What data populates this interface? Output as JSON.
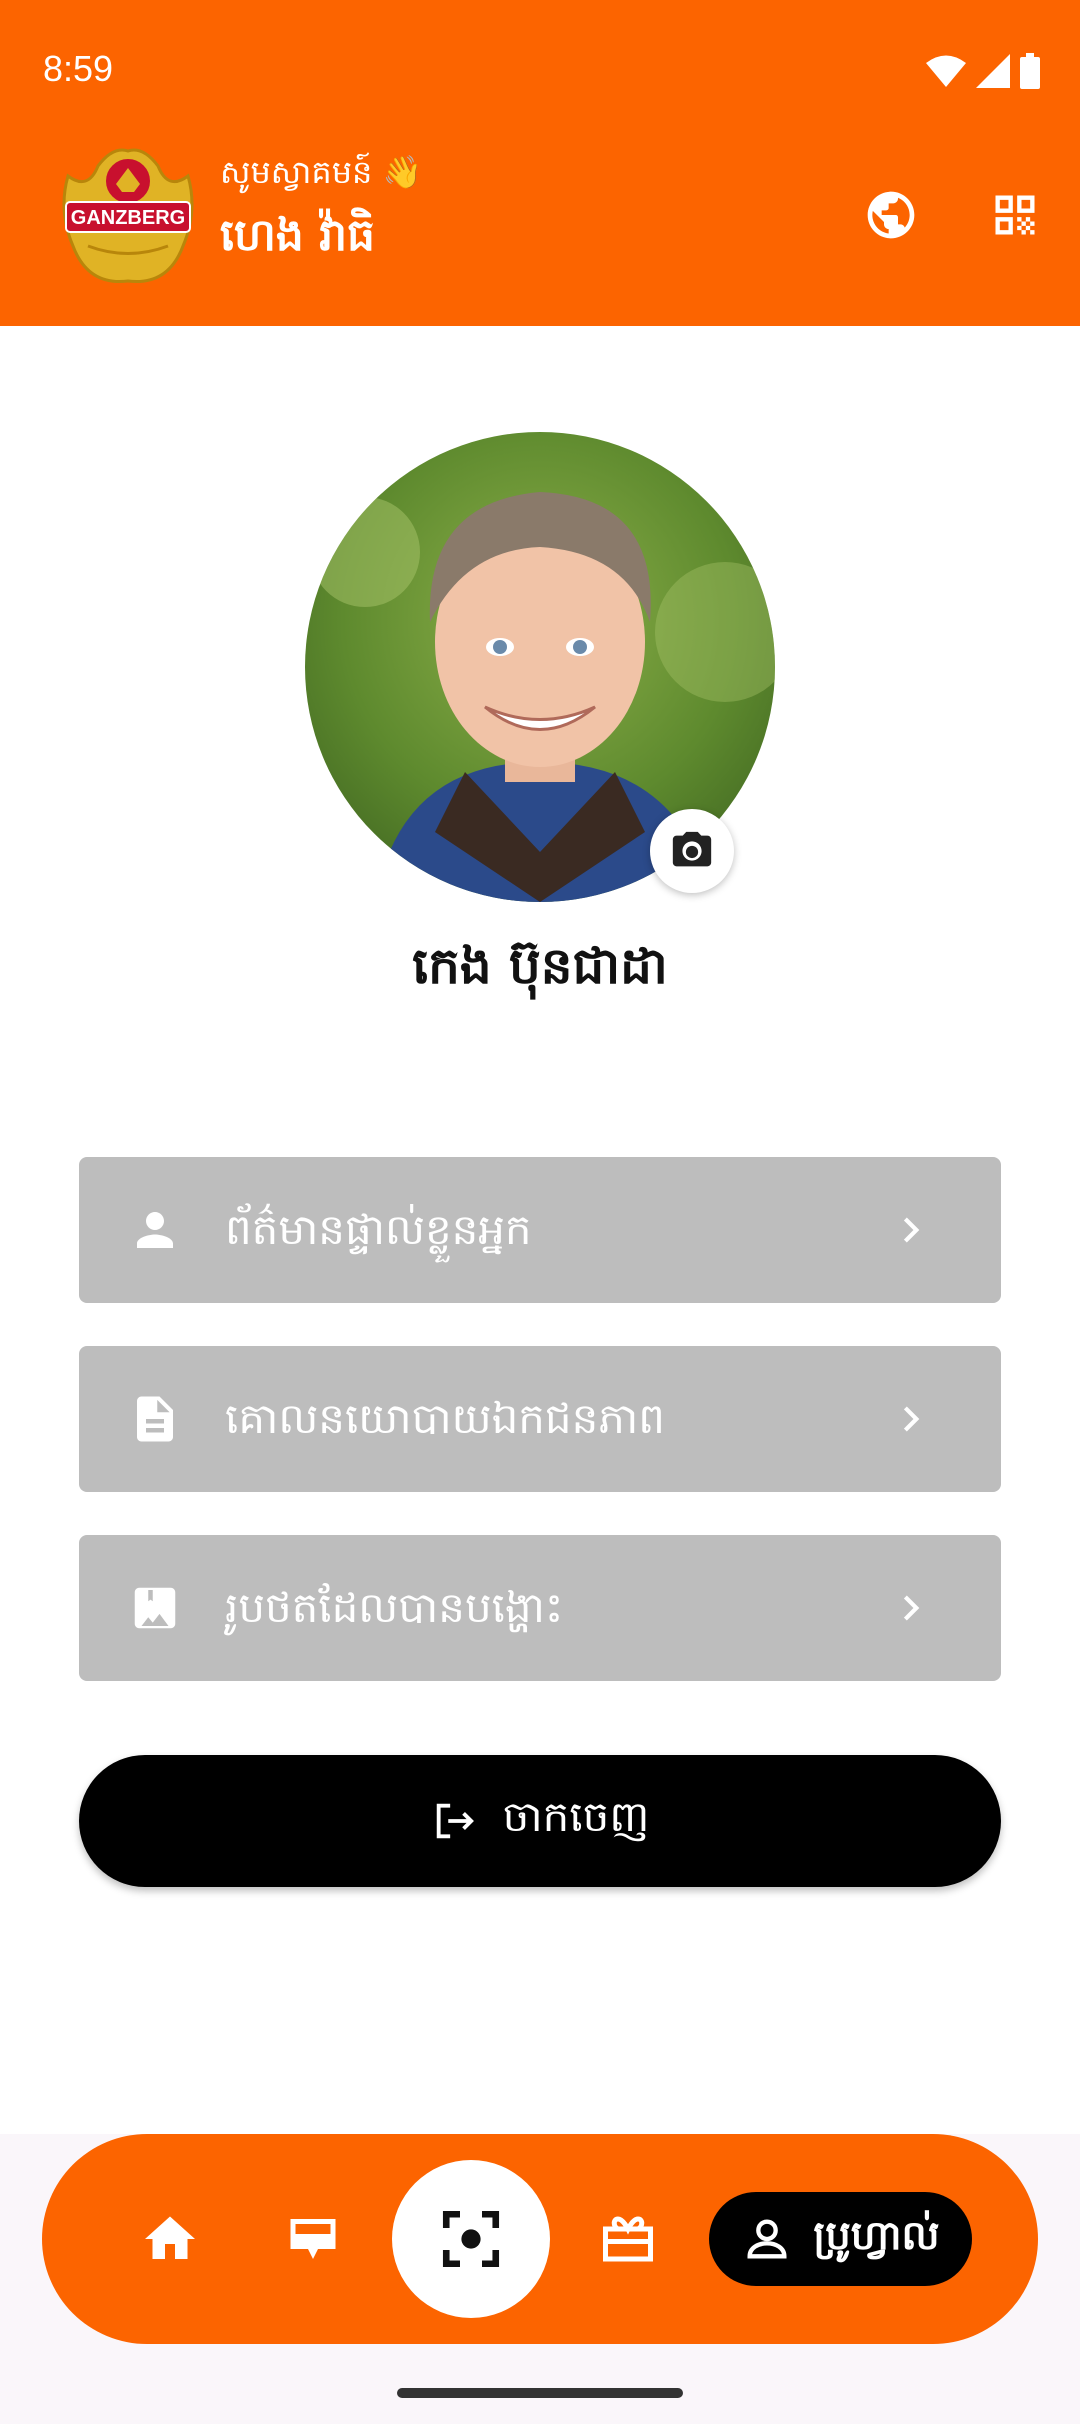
{
  "status_bar": {
    "time": "8:59"
  },
  "header": {
    "greeting": "សូមស្វាគមន៍ 👋",
    "user_name": "ហេង វ៉ាធិ",
    "logo_text": "GANZBERG",
    "accent_color": "#FC6400"
  },
  "profile": {
    "name": "កេង ប៊ុនជាដា"
  },
  "menu": [
    {
      "icon": "person-icon",
      "label": "ព័ត៌មានផ្ទាល់ខ្លួនអ្នក"
    },
    {
      "icon": "document-icon",
      "label": "គោលនយោបាយឯកជនភាព"
    },
    {
      "icon": "bookmark-image-icon",
      "label": "រូបថតដែលបានបង្ហោះ"
    }
  ],
  "logout": {
    "label": "ចាកចេញ"
  },
  "bottom_nav": {
    "items": [
      "home-icon",
      "ticket-icon",
      "scan-icon",
      "gift-icon"
    ],
    "profile_label": "ប្រូហ្វាល់"
  }
}
